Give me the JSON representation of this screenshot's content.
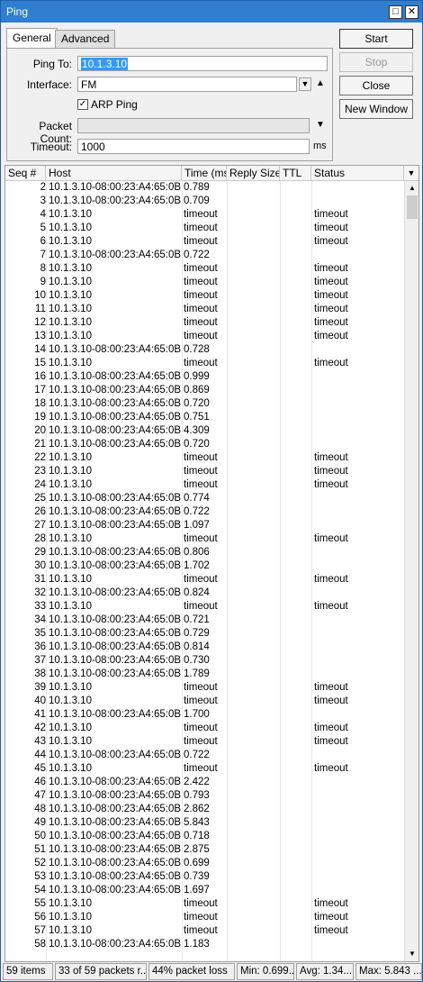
{
  "window": {
    "title": "Ping",
    "restore_glyph": "□",
    "close_glyph": "✕"
  },
  "tabs": [
    {
      "label": "General",
      "active": true
    },
    {
      "label": "Advanced",
      "active": false
    }
  ],
  "form": {
    "ping_to_label": "Ping To:",
    "ping_to_value": "10.1.3.10",
    "interface_label": "Interface:",
    "interface_value": "FM",
    "arp_ping_label": "ARP Ping",
    "arp_ping_checked": true,
    "packet_count_label": "Packet Count:",
    "packet_count_value": "",
    "timeout_label": "Timeout:",
    "timeout_value": "1000",
    "timeout_unit": "ms"
  },
  "buttons": {
    "start": "Start",
    "stop": "Stop",
    "close": "Close",
    "new_window": "New Window"
  },
  "table": {
    "columns": [
      "Seq #",
      "Host",
      "Time (ms)",
      "Reply Size",
      "TTL",
      "Status"
    ],
    "rows": [
      {
        "seq": "2",
        "host": "10.1.3.10-08:00:23:A4:65:0B",
        "time": "0.789",
        "status": ""
      },
      {
        "seq": "3",
        "host": "10.1.3.10-08:00:23:A4:65:0B",
        "time": "0.709",
        "status": ""
      },
      {
        "seq": "4",
        "host": "10.1.3.10",
        "time": "timeout",
        "status": "timeout"
      },
      {
        "seq": "5",
        "host": "10.1.3.10",
        "time": "timeout",
        "status": "timeout"
      },
      {
        "seq": "6",
        "host": "10.1.3.10",
        "time": "timeout",
        "status": "timeout"
      },
      {
        "seq": "7",
        "host": "10.1.3.10-08:00:23:A4:65:0B",
        "time": "0.722",
        "status": ""
      },
      {
        "seq": "8",
        "host": "10.1.3.10",
        "time": "timeout",
        "status": "timeout"
      },
      {
        "seq": "9",
        "host": "10.1.3.10",
        "time": "timeout",
        "status": "timeout"
      },
      {
        "seq": "10",
        "host": "10.1.3.10",
        "time": "timeout",
        "status": "timeout"
      },
      {
        "seq": "11",
        "host": "10.1.3.10",
        "time": "timeout",
        "status": "timeout"
      },
      {
        "seq": "12",
        "host": "10.1.3.10",
        "time": "timeout",
        "status": "timeout"
      },
      {
        "seq": "13",
        "host": "10.1.3.10",
        "time": "timeout",
        "status": "timeout"
      },
      {
        "seq": "14",
        "host": "10.1.3.10-08:00:23:A4:65:0B",
        "time": "0.728",
        "status": ""
      },
      {
        "seq": "15",
        "host": "10.1.3.10",
        "time": "timeout",
        "status": "timeout"
      },
      {
        "seq": "16",
        "host": "10.1.3.10-08:00:23:A4:65:0B",
        "time": "0.999",
        "status": ""
      },
      {
        "seq": "17",
        "host": "10.1.3.10-08:00:23:A4:65:0B",
        "time": "0.869",
        "status": ""
      },
      {
        "seq": "18",
        "host": "10.1.3.10-08:00:23:A4:65:0B",
        "time": "0.720",
        "status": ""
      },
      {
        "seq": "19",
        "host": "10.1.3.10-08:00:23:A4:65:0B",
        "time": "0.751",
        "status": ""
      },
      {
        "seq": "20",
        "host": "10.1.3.10-08:00:23:A4:65:0B",
        "time": "4.309",
        "status": ""
      },
      {
        "seq": "21",
        "host": "10.1.3.10-08:00:23:A4:65:0B",
        "time": "0.720",
        "status": ""
      },
      {
        "seq": "22",
        "host": "10.1.3.10",
        "time": "timeout",
        "status": "timeout"
      },
      {
        "seq": "23",
        "host": "10.1.3.10",
        "time": "timeout",
        "status": "timeout"
      },
      {
        "seq": "24",
        "host": "10.1.3.10",
        "time": "timeout",
        "status": "timeout"
      },
      {
        "seq": "25",
        "host": "10.1.3.10-08:00:23:A4:65:0B",
        "time": "0.774",
        "status": ""
      },
      {
        "seq": "26",
        "host": "10.1.3.10-08:00:23:A4:65:0B",
        "time": "0.722",
        "status": ""
      },
      {
        "seq": "27",
        "host": "10.1.3.10-08:00:23:A4:65:0B",
        "time": "1.097",
        "status": ""
      },
      {
        "seq": "28",
        "host": "10.1.3.10",
        "time": "timeout",
        "status": "timeout"
      },
      {
        "seq": "29",
        "host": "10.1.3.10-08:00:23:A4:65:0B",
        "time": "0.806",
        "status": ""
      },
      {
        "seq": "30",
        "host": "10.1.3.10-08:00:23:A4:65:0B",
        "time": "1.702",
        "status": ""
      },
      {
        "seq": "31",
        "host": "10.1.3.10",
        "time": "timeout",
        "status": "timeout"
      },
      {
        "seq": "32",
        "host": "10.1.3.10-08:00:23:A4:65:0B",
        "time": "0.824",
        "status": ""
      },
      {
        "seq": "33",
        "host": "10.1.3.10",
        "time": "timeout",
        "status": "timeout"
      },
      {
        "seq": "34",
        "host": "10.1.3.10-08:00:23:A4:65:0B",
        "time": "0.721",
        "status": ""
      },
      {
        "seq": "35",
        "host": "10.1.3.10-08:00:23:A4:65:0B",
        "time": "0.729",
        "status": ""
      },
      {
        "seq": "36",
        "host": "10.1.3.10-08:00:23:A4:65:0B",
        "time": "0.814",
        "status": ""
      },
      {
        "seq": "37",
        "host": "10.1.3.10-08:00:23:A4:65:0B",
        "time": "0.730",
        "status": ""
      },
      {
        "seq": "38",
        "host": "10.1.3.10-08:00:23:A4:65:0B",
        "time": "1.789",
        "status": ""
      },
      {
        "seq": "39",
        "host": "10.1.3.10",
        "time": "timeout",
        "status": "timeout"
      },
      {
        "seq": "40",
        "host": "10.1.3.10",
        "time": "timeout",
        "status": "timeout"
      },
      {
        "seq": "41",
        "host": "10.1.3.10-08:00:23:A4:65:0B",
        "time": "1.700",
        "status": ""
      },
      {
        "seq": "42",
        "host": "10.1.3.10",
        "time": "timeout",
        "status": "timeout"
      },
      {
        "seq": "43",
        "host": "10.1.3.10",
        "time": "timeout",
        "status": "timeout"
      },
      {
        "seq": "44",
        "host": "10.1.3.10-08:00:23:A4:65:0B",
        "time": "0.722",
        "status": ""
      },
      {
        "seq": "45",
        "host": "10.1.3.10",
        "time": "timeout",
        "status": "timeout"
      },
      {
        "seq": "46",
        "host": "10.1.3.10-08:00:23:A4:65:0B",
        "time": "2.422",
        "status": ""
      },
      {
        "seq": "47",
        "host": "10.1.3.10-08:00:23:A4:65:0B",
        "time": "0.793",
        "status": ""
      },
      {
        "seq": "48",
        "host": "10.1.3.10-08:00:23:A4:65:0B",
        "time": "2.862",
        "status": ""
      },
      {
        "seq": "49",
        "host": "10.1.3.10-08:00:23:A4:65:0B",
        "time": "5.843",
        "status": ""
      },
      {
        "seq": "50",
        "host": "10.1.3.10-08:00:23:A4:65:0B",
        "time": "0.718",
        "status": ""
      },
      {
        "seq": "51",
        "host": "10.1.3.10-08:00:23:A4:65:0B",
        "time": "2.875",
        "status": ""
      },
      {
        "seq": "52",
        "host": "10.1.3.10-08:00:23:A4:65:0B",
        "time": "0.699",
        "status": ""
      },
      {
        "seq": "53",
        "host": "10.1.3.10-08:00:23:A4:65:0B",
        "time": "0.739",
        "status": ""
      },
      {
        "seq": "54",
        "host": "10.1.3.10-08:00:23:A4:65:0B",
        "time": "1.697",
        "status": ""
      },
      {
        "seq": "55",
        "host": "10.1.3.10",
        "time": "timeout",
        "status": "timeout"
      },
      {
        "seq": "56",
        "host": "10.1.3.10",
        "time": "timeout",
        "status": "timeout"
      },
      {
        "seq": "57",
        "host": "10.1.3.10",
        "time": "timeout",
        "status": "timeout"
      },
      {
        "seq": "58",
        "host": "10.1.3.10-08:00:23:A4:65:0B",
        "time": "1.183",
        "status": ""
      }
    ]
  },
  "statusbar": {
    "items": "59 items",
    "packets": "33 of 59 packets r...",
    "loss": "44% packet loss",
    "min": "Min: 0.699...",
    "avg": "Avg: 1.34...",
    "max": "Max: 5.843 ..."
  },
  "colors": {
    "titlebar": "#2f7ed0",
    "selection": "#3399ff"
  }
}
